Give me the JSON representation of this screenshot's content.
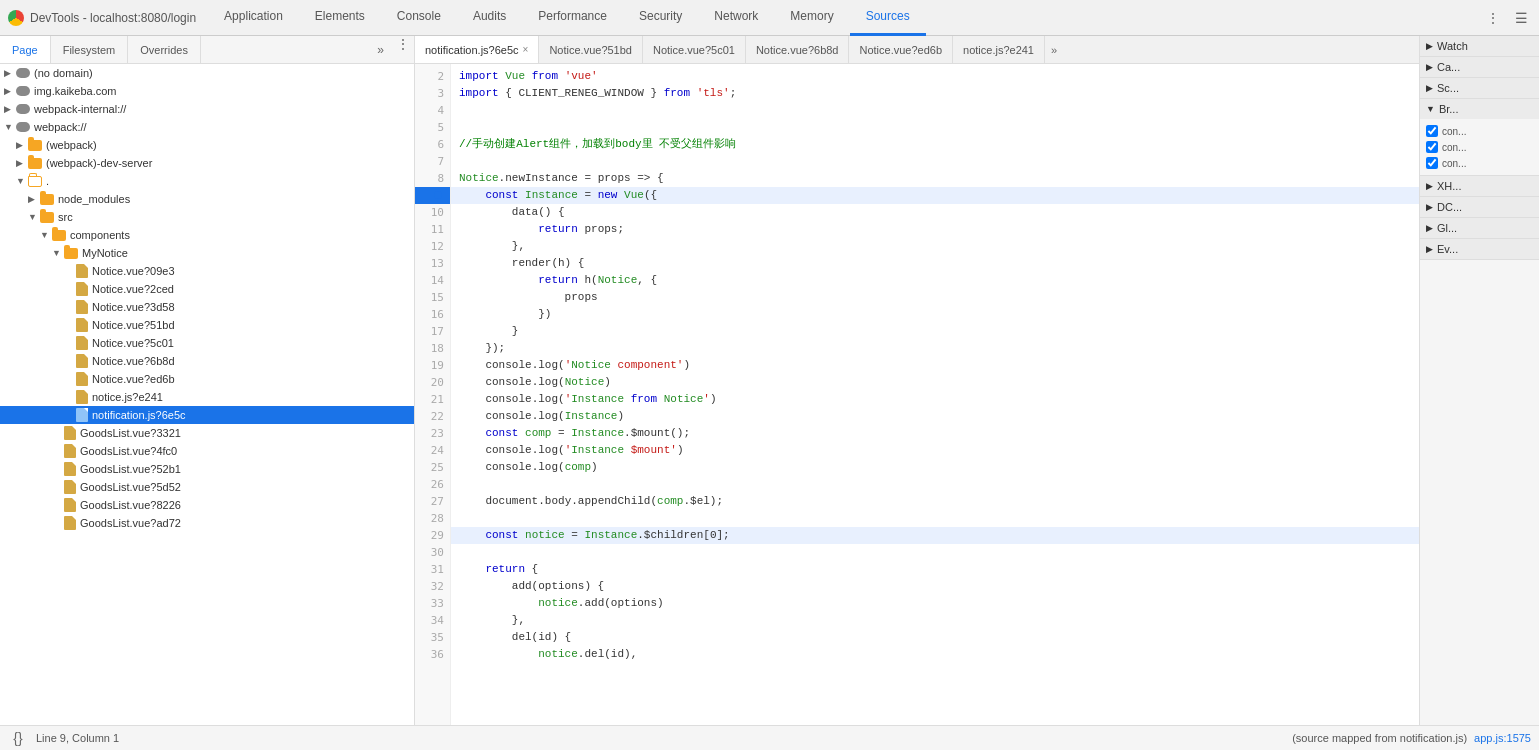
{
  "window": {
    "title": "DevTools - localhost:8080/login"
  },
  "nav": {
    "tabs": [
      {
        "id": "application",
        "label": "Application",
        "active": false
      },
      {
        "id": "elements",
        "label": "Elements",
        "active": false
      },
      {
        "id": "console",
        "label": "Console",
        "active": false
      },
      {
        "id": "audits",
        "label": "Audits",
        "active": false
      },
      {
        "id": "performance",
        "label": "Performance",
        "active": false
      },
      {
        "id": "security",
        "label": "Security",
        "active": false
      },
      {
        "id": "network",
        "label": "Network",
        "active": false
      },
      {
        "id": "memory",
        "label": "Memory",
        "active": false
      },
      {
        "id": "sources",
        "label": "Sources",
        "active": true
      }
    ]
  },
  "left_panel": {
    "tabs": [
      {
        "id": "page",
        "label": "Page",
        "active": true
      },
      {
        "id": "filesystem",
        "label": "Filesystem",
        "active": false
      },
      {
        "id": "overrides",
        "label": "Overrides",
        "active": false
      }
    ],
    "tree": [
      {
        "id": "no-domain",
        "label": "(no domain)",
        "type": "cloud",
        "depth": 0,
        "expanded": false
      },
      {
        "id": "img-kaikeba",
        "label": "img.kaikeba.com",
        "type": "cloud",
        "depth": 0,
        "expanded": false
      },
      {
        "id": "webpack-internal",
        "label": "webpack-internal://",
        "type": "cloud",
        "depth": 0,
        "expanded": false
      },
      {
        "id": "webpack-proto",
        "label": "webpack://",
        "type": "cloud-outlined",
        "depth": 0,
        "expanded": true
      },
      {
        "id": "webpack-folder",
        "label": "(webpack)",
        "type": "folder",
        "depth": 1,
        "expanded": false
      },
      {
        "id": "webpack-dev-server",
        "label": "(webpack)-dev-server",
        "type": "folder",
        "depth": 1,
        "expanded": false
      },
      {
        "id": "dot-folder",
        "label": ".",
        "type": "folder-outlined",
        "depth": 1,
        "expanded": true
      },
      {
        "id": "node-modules",
        "label": "node_modules",
        "type": "folder",
        "depth": 2,
        "expanded": false
      },
      {
        "id": "src-folder",
        "label": "src",
        "type": "folder",
        "depth": 2,
        "expanded": true
      },
      {
        "id": "components",
        "label": "components",
        "type": "folder",
        "depth": 3,
        "expanded": true
      },
      {
        "id": "mynotice",
        "label": "MyNotice",
        "type": "folder",
        "depth": 4,
        "expanded": true
      },
      {
        "id": "notice-vue-09e3",
        "label": "Notice.vue?09e3",
        "type": "file",
        "depth": 5,
        "expanded": false
      },
      {
        "id": "notice-vue-2ced",
        "label": "Notice.vue?2ced",
        "type": "file",
        "depth": 5,
        "expanded": false
      },
      {
        "id": "notice-vue-3d58",
        "label": "Notice.vue?3d58",
        "type": "file",
        "depth": 5,
        "expanded": false
      },
      {
        "id": "notice-vue-51bd",
        "label": "Notice.vue?51bd",
        "type": "file",
        "depth": 5,
        "expanded": false
      },
      {
        "id": "notice-vue-5c01",
        "label": "Notice.vue?5c01",
        "type": "file",
        "depth": 5,
        "expanded": false
      },
      {
        "id": "notice-vue-6b8d",
        "label": "Notice.vue?6b8d",
        "type": "file",
        "depth": 5,
        "expanded": false
      },
      {
        "id": "notice-vue-ed6b",
        "label": "Notice.vue?ed6b",
        "type": "file",
        "depth": 5,
        "expanded": false
      },
      {
        "id": "notice-js-e241",
        "label": "notice.js?e241",
        "type": "file",
        "depth": 5,
        "expanded": false
      },
      {
        "id": "notification-js-6e5c",
        "label": "notification.js?6e5c",
        "type": "file-active",
        "depth": 5,
        "expanded": false,
        "selected": true
      },
      {
        "id": "goodslist-3321",
        "label": "GoodsList.vue?3321",
        "type": "file",
        "depth": 4,
        "expanded": false
      },
      {
        "id": "goodslist-4fc0",
        "label": "GoodsList.vue?4fc0",
        "type": "file",
        "depth": 4,
        "expanded": false
      },
      {
        "id": "goodslist-52b1",
        "label": "GoodsList.vue?52b1",
        "type": "file",
        "depth": 4,
        "expanded": false
      },
      {
        "id": "goodslist-5d52",
        "label": "GoodsList.vue?5d52",
        "type": "file",
        "depth": 4,
        "expanded": false
      },
      {
        "id": "goodslist-8226",
        "label": "GoodsList.vue?8226",
        "type": "file",
        "depth": 4,
        "expanded": false
      },
      {
        "id": "goodslist-ad72",
        "label": "GoodsList.vue?ad72",
        "type": "file",
        "depth": 4,
        "expanded": false
      }
    ]
  },
  "code_tabs": [
    {
      "id": "notification-6e5c",
      "label": "notification.js?6e5c",
      "active": true,
      "closeable": true
    },
    {
      "id": "notice-51bd",
      "label": "Notice.vue?51bd",
      "active": false,
      "closeable": false
    },
    {
      "id": "notice-5c01",
      "label": "Notice.vue?5c01",
      "active": false,
      "closeable": false
    },
    {
      "id": "notice-6b8d",
      "label": "Notice.vue?6b8d",
      "active": false,
      "closeable": false
    },
    {
      "id": "notice-ed6b",
      "label": "Notice.vue?ed6b",
      "active": false,
      "closeable": false
    },
    {
      "id": "notice-js-e241",
      "label": "notice.js?e241",
      "active": false,
      "closeable": false
    }
  ],
  "code": {
    "lines": [
      {
        "num": "2",
        "content": "import Vue from 'vue'",
        "highlighted": false,
        "breakpoint": false
      },
      {
        "num": "3",
        "content": "import { CLIENT_RENEG_WINDOW } from 'tls';",
        "highlighted": false,
        "breakpoint": false
      },
      {
        "num": "4",
        "content": "",
        "highlighted": false,
        "breakpoint": false
      },
      {
        "num": "5",
        "content": "",
        "highlighted": false,
        "breakpoint": false
      },
      {
        "num": "6",
        "content": "//手动创建Alert组件，加载到body里 不受父组件影响",
        "highlighted": false,
        "breakpoint": false
      },
      {
        "num": "7",
        "content": "",
        "highlighted": false,
        "breakpoint": false
      },
      {
        "num": "8",
        "content": "Notice.newInstance = props => {",
        "highlighted": false,
        "breakpoint": false
      },
      {
        "num": "9",
        "content": "    const Instance = new Vue({",
        "highlighted": true,
        "breakpoint": true
      },
      {
        "num": "10",
        "content": "        data() {",
        "highlighted": false,
        "breakpoint": false
      },
      {
        "num": "11",
        "content": "            return props;",
        "highlighted": false,
        "breakpoint": false
      },
      {
        "num": "12",
        "content": "        },",
        "highlighted": false,
        "breakpoint": false
      },
      {
        "num": "13",
        "content": "        render(h) {",
        "highlighted": false,
        "breakpoint": false
      },
      {
        "num": "14",
        "content": "            return h(Notice, {",
        "highlighted": false,
        "breakpoint": false
      },
      {
        "num": "15",
        "content": "                props",
        "highlighted": false,
        "breakpoint": false
      },
      {
        "num": "16",
        "content": "            })",
        "highlighted": false,
        "breakpoint": false
      },
      {
        "num": "17",
        "content": "        }",
        "highlighted": false,
        "breakpoint": false
      },
      {
        "num": "18",
        "content": "    });",
        "highlighted": false,
        "breakpoint": false
      },
      {
        "num": "19",
        "content": "    console.log('Notice component')",
        "highlighted": false,
        "breakpoint": false
      },
      {
        "num": "20",
        "content": "    console.log(Notice)",
        "highlighted": false,
        "breakpoint": false
      },
      {
        "num": "21",
        "content": "    console.log('Instance from Notice')",
        "highlighted": false,
        "breakpoint": false
      },
      {
        "num": "22",
        "content": "    console.log(Instance)",
        "highlighted": false,
        "breakpoint": false
      },
      {
        "num": "23",
        "content": "    const comp = Instance.$mount();",
        "highlighted": false,
        "breakpoint": false
      },
      {
        "num": "24",
        "content": "    console.log('Instance $mount')",
        "highlighted": false,
        "breakpoint": false
      },
      {
        "num": "25",
        "content": "    console.log(comp)",
        "highlighted": false,
        "breakpoint": false
      },
      {
        "num": "26",
        "content": "",
        "highlighted": false,
        "breakpoint": false
      },
      {
        "num": "27",
        "content": "    document.body.appendChild(comp.$el);",
        "highlighted": false,
        "breakpoint": false
      },
      {
        "num": "28",
        "content": "",
        "highlighted": false,
        "breakpoint": false
      },
      {
        "num": "29",
        "content": "    const notice = Instance.$children[0];",
        "highlighted": true,
        "breakpoint": false
      },
      {
        "num": "30",
        "content": "",
        "highlighted": false,
        "breakpoint": false
      },
      {
        "num": "31",
        "content": "    return {",
        "highlighted": false,
        "breakpoint": false
      },
      {
        "num": "32",
        "content": "        add(options) {",
        "highlighted": false,
        "breakpoint": false
      },
      {
        "num": "33",
        "content": "            notice.add(options)",
        "highlighted": false,
        "breakpoint": false
      },
      {
        "num": "34",
        "content": "        },",
        "highlighted": false,
        "breakpoint": false
      },
      {
        "num": "35",
        "content": "        del(id) {",
        "highlighted": false,
        "breakpoint": false
      },
      {
        "num": "36",
        "content": "            notice.del(id),",
        "highlighted": false,
        "breakpoint": false
      }
    ]
  },
  "right_panel": {
    "sections": [
      {
        "id": "watch",
        "label": "Watch",
        "expanded": false,
        "prefix": "▶"
      },
      {
        "id": "call-stack",
        "label": "Ca...",
        "expanded": false,
        "prefix": "▶"
      },
      {
        "id": "scope",
        "label": "Sc...",
        "expanded": false,
        "prefix": "▶"
      },
      {
        "id": "breakpoints",
        "label": "Br...",
        "expanded": true,
        "prefix": "▼",
        "checkboxes": [
          {
            "id": "cb1",
            "label": "con...",
            "checked": true
          },
          {
            "id": "cb2",
            "label": "con...",
            "checked": true
          },
          {
            "id": "cb3",
            "label": "con...",
            "checked": true
          }
        ]
      },
      {
        "id": "xhr",
        "label": "XH...",
        "expanded": false,
        "prefix": "▶"
      },
      {
        "id": "dom",
        "label": "DC...",
        "expanded": false,
        "prefix": "▶"
      },
      {
        "id": "global",
        "label": "Gl...",
        "expanded": false,
        "prefix": "▶"
      },
      {
        "id": "event",
        "label": "Ev...",
        "expanded": false,
        "prefix": "▶"
      }
    ]
  },
  "status_bar": {
    "line_col": "Line 9, Column 1",
    "source_map": "(source mapped from notification.js)",
    "app_link": "app.js:1575",
    "format_icon": "{}"
  }
}
